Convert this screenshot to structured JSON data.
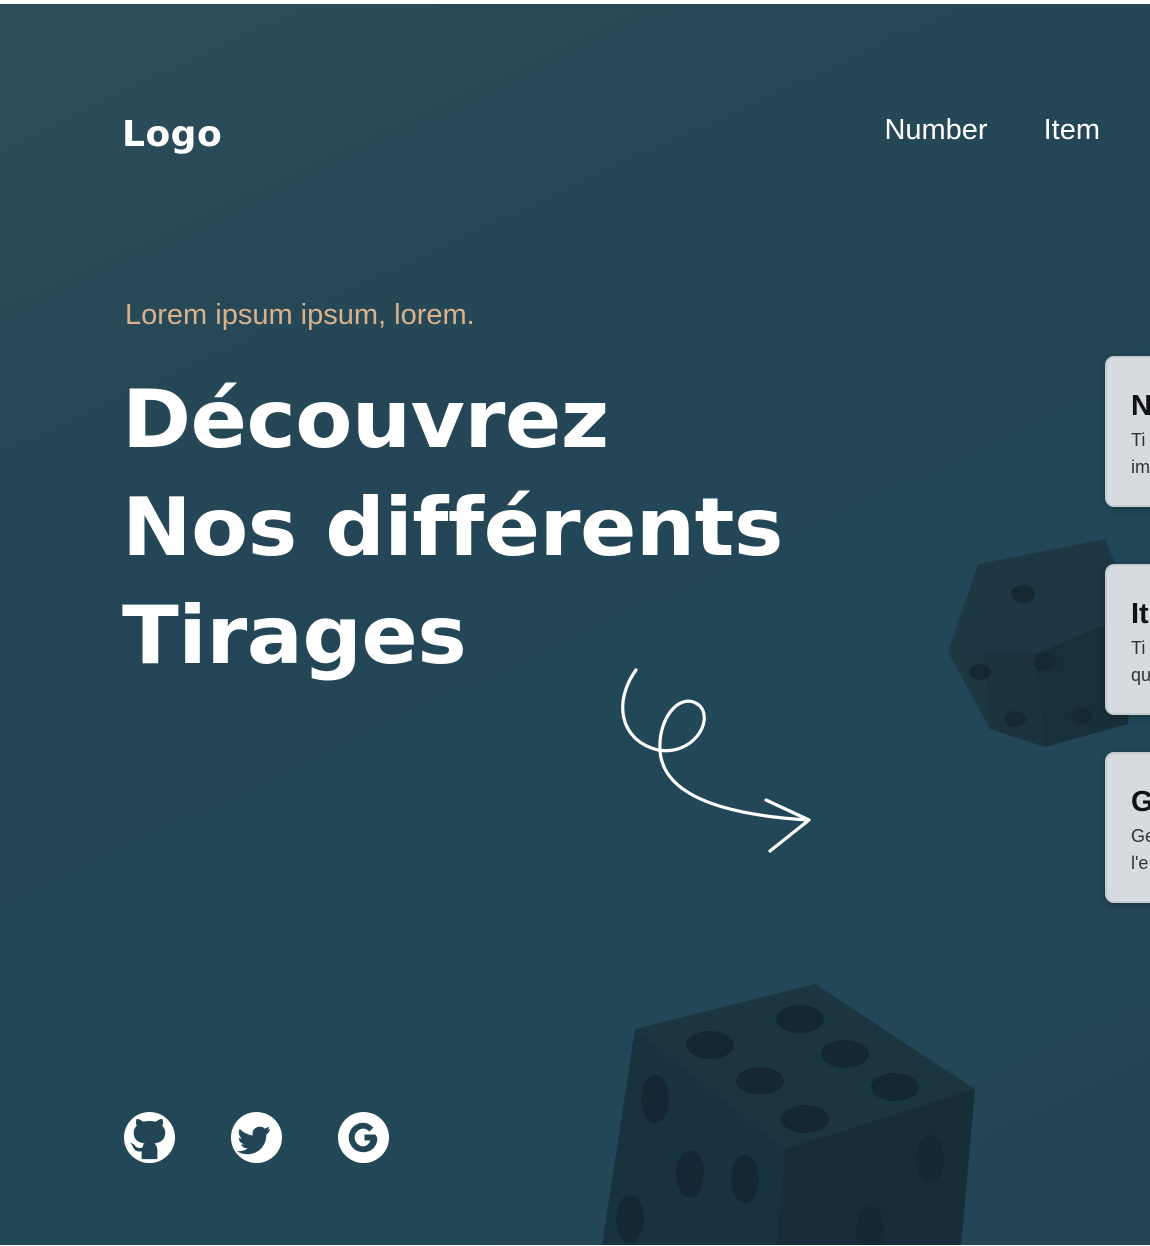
{
  "header": {
    "logo": "Logo",
    "nav": [
      "Number",
      "Item"
    ]
  },
  "hero": {
    "eyebrow": "Lorem ipsum ipsum, lorem.",
    "headline": [
      "Découvrez",
      "Nos différents",
      "Tirages"
    ]
  },
  "cards": [
    {
      "title": "N",
      "lines": [
        "Ti",
        "im"
      ]
    },
    {
      "title": "It",
      "lines": [
        "Ti",
        "qu"
      ]
    },
    {
      "title": "G",
      "lines": [
        "Ge",
        "l'e"
      ]
    }
  ],
  "socials": [
    "github-icon",
    "twitter-icon",
    "google-icon"
  ],
  "colors": {
    "background": "#244656",
    "accent": "#d9b28c",
    "text": "#ffffff",
    "card": "#d6dbdf"
  }
}
